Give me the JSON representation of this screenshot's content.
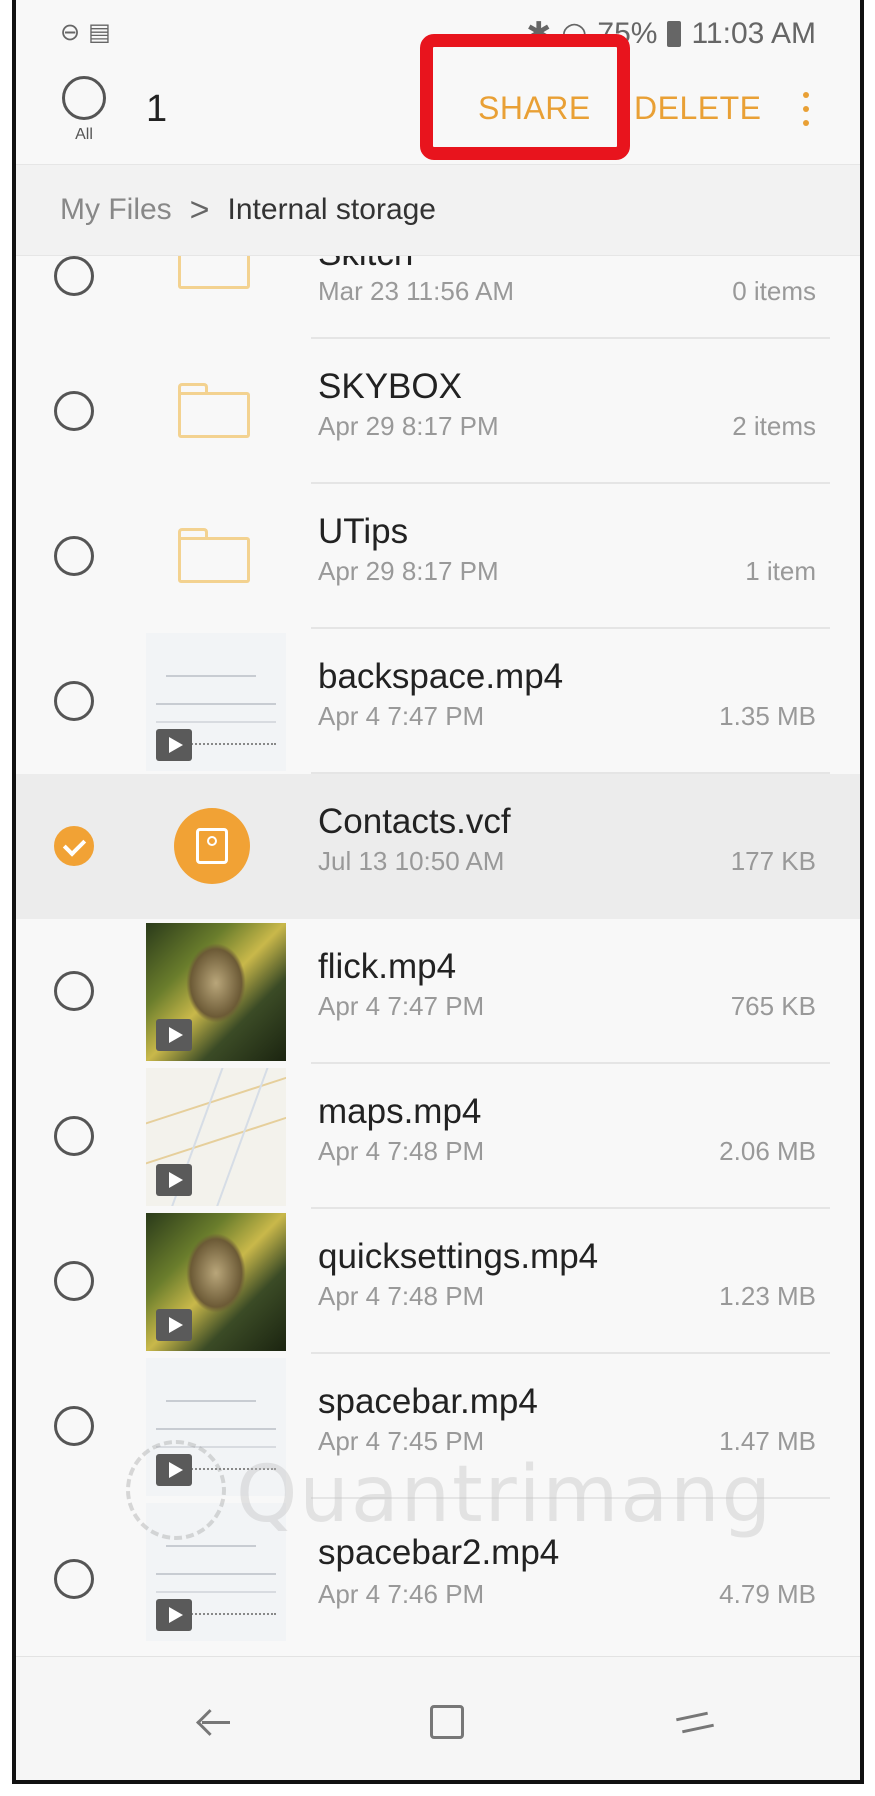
{
  "status_bar": {
    "battery": "75%",
    "time": "11:03 AM"
  },
  "action_bar": {
    "select_all_label": "All",
    "selected_count": "1",
    "share_label": "SHARE",
    "delete_label": "DELETE",
    "more_icon": "more-vert-icon"
  },
  "breadcrumb": {
    "root": "My Files",
    "separator": ">",
    "current": "Internal storage"
  },
  "files": [
    {
      "name": "Skitch",
      "date": "Mar 23 11:56 AM",
      "meta": "0 items",
      "type": "folder",
      "selected": false
    },
    {
      "name": "SKYBOX",
      "date": "Apr 29 8:17 PM",
      "meta": "2 items",
      "type": "folder",
      "selected": false
    },
    {
      "name": "UTips",
      "date": "Apr 29 8:17 PM",
      "meta": "1 item",
      "type": "folder",
      "selected": false
    },
    {
      "name": "backspace.mp4",
      "date": "Apr 4 7:47 PM",
      "meta": "1.35 MB",
      "type": "video",
      "selected": false
    },
    {
      "name": "Contacts.vcf",
      "date": "Jul 13 10:50 AM",
      "meta": "177 KB",
      "type": "contact",
      "selected": true
    },
    {
      "name": "flick.mp4",
      "date": "Apr 4 7:47 PM",
      "meta": "765 KB",
      "type": "video",
      "selected": false
    },
    {
      "name": "maps.mp4",
      "date": "Apr 4 7:48 PM",
      "meta": "2.06 MB",
      "type": "video",
      "selected": false
    },
    {
      "name": "quicksettings.mp4",
      "date": "Apr 4 7:48 PM",
      "meta": "1.23 MB",
      "type": "video",
      "selected": false
    },
    {
      "name": "spacebar.mp4",
      "date": "Apr 4 7:45 PM",
      "meta": "1.47 MB",
      "type": "video",
      "selected": false
    },
    {
      "name": "spacebar2.mp4",
      "date": "Apr 4 7:46 PM",
      "meta": "4.79 MB",
      "type": "video",
      "selected": false
    }
  ],
  "watermark": "Quantrimang",
  "colors": {
    "accent": "#f1a235",
    "highlight_box": "#e8141d"
  }
}
